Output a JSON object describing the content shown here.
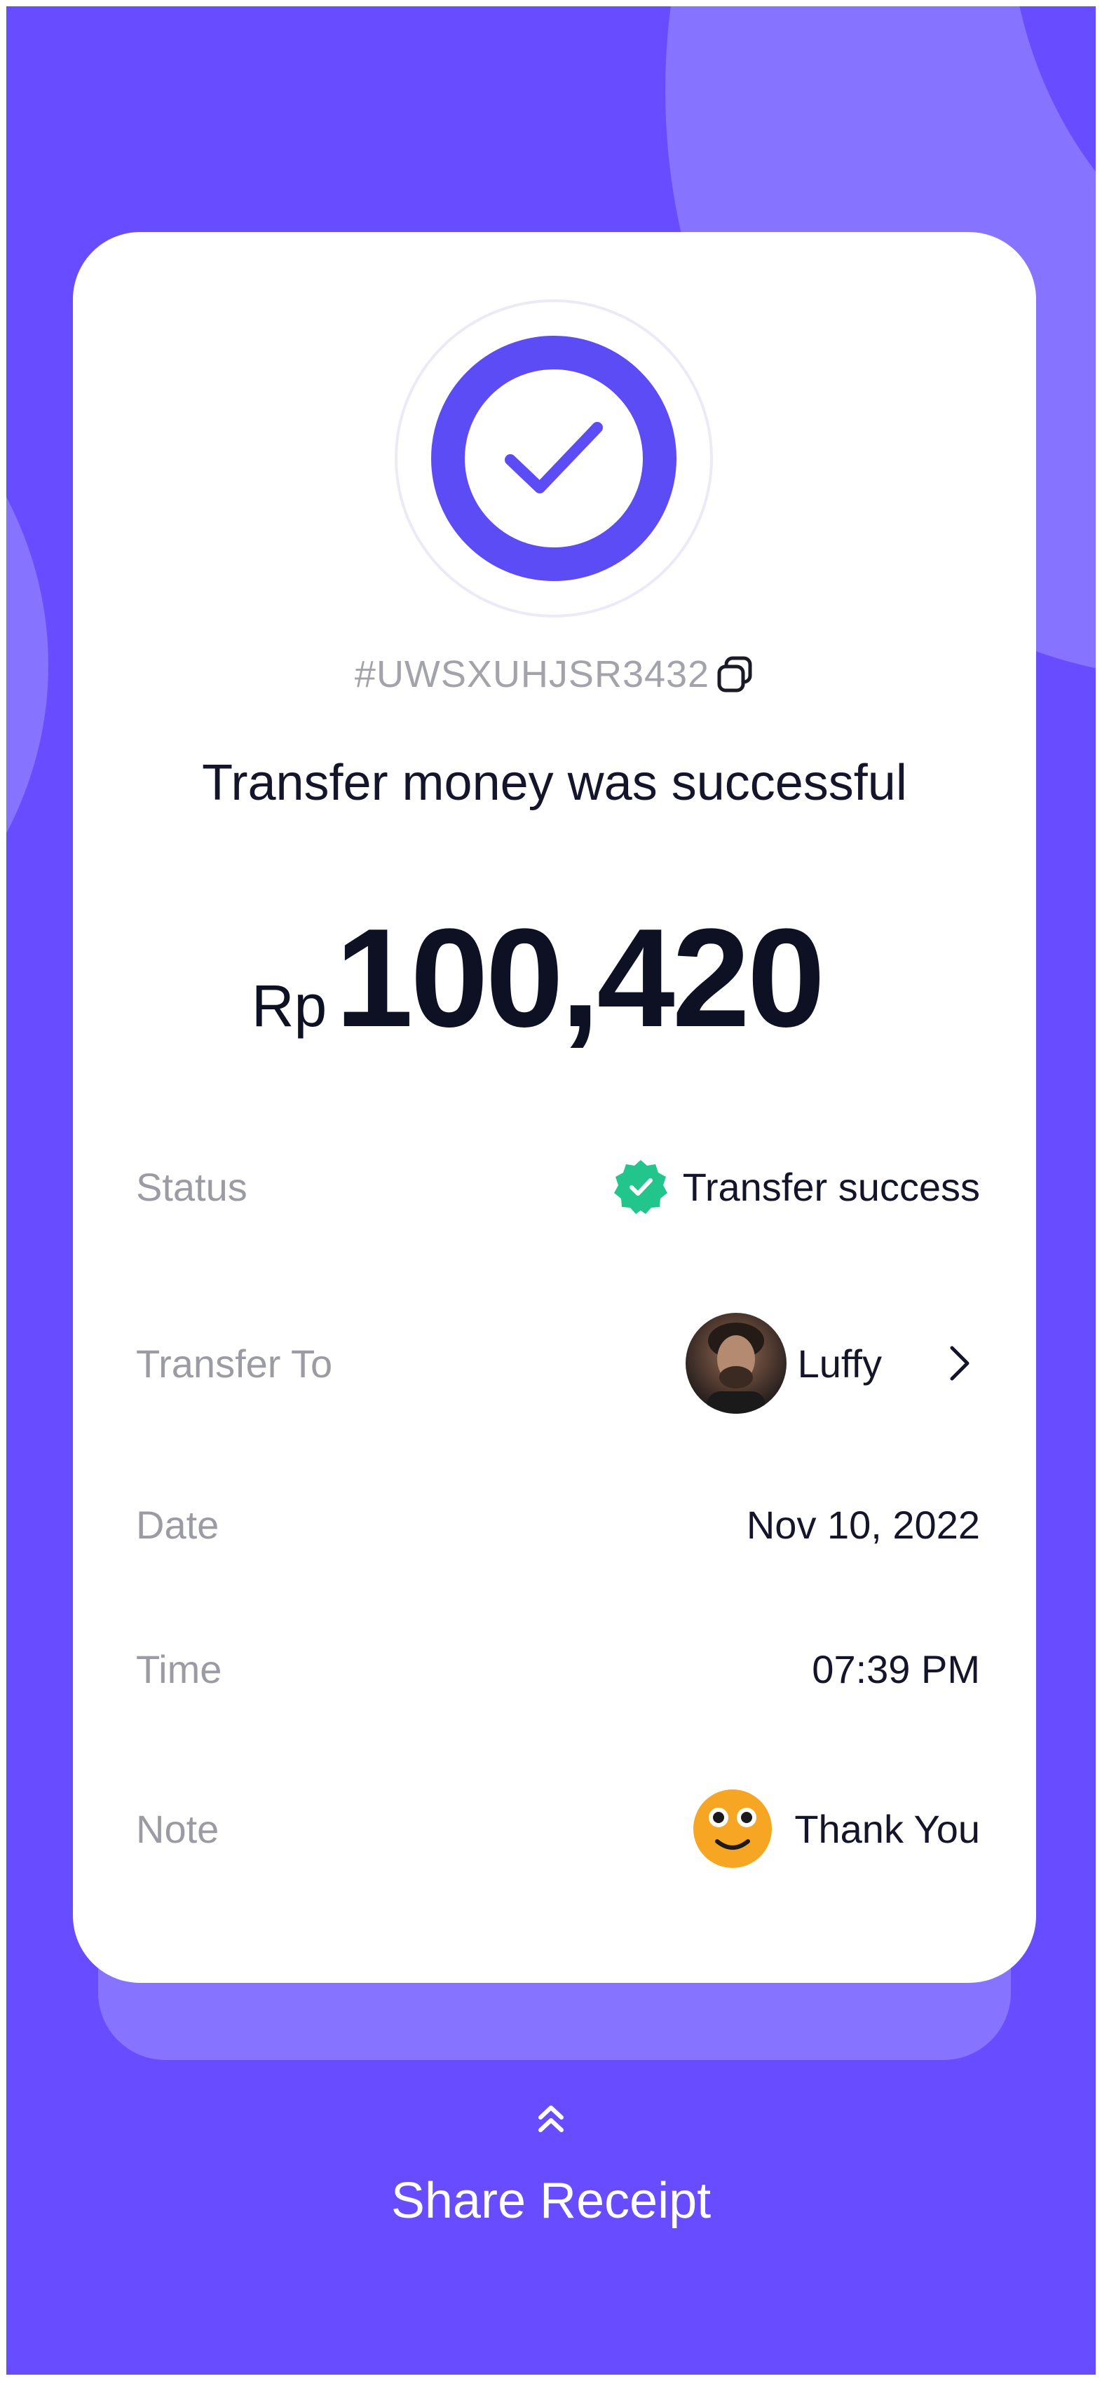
{
  "colors": {
    "background": "#684CFF",
    "accent": "#5B4CF5",
    "success": "#22C58B",
    "text_primary": "#14142B",
    "text_muted": "#9B9BA3"
  },
  "receipt": {
    "transaction_id": "#UWSXUHJSR3432",
    "headline": "Transfer money was successful",
    "currency": "Rp",
    "amount": "100,420"
  },
  "details": {
    "status": {
      "label": "Status",
      "value": "Transfer success"
    },
    "transfer_to": {
      "label": "Transfer To",
      "value": "Luffy"
    },
    "date": {
      "label": "Date",
      "value": "Nov 10, 2022"
    },
    "time": {
      "label": "Time",
      "value": "07:39 PM"
    },
    "note": {
      "label": "Note",
      "value": "Thank You"
    }
  },
  "icons": {
    "success": "check-icon",
    "copy": "copy-icon",
    "status": "verified-badge-icon",
    "recipient": "avatar",
    "chevron": "chevron-right-icon",
    "note": "smiley-emoji-icon",
    "share": "double-chevron-up-icon"
  },
  "share": {
    "label": "Share Receipt"
  }
}
